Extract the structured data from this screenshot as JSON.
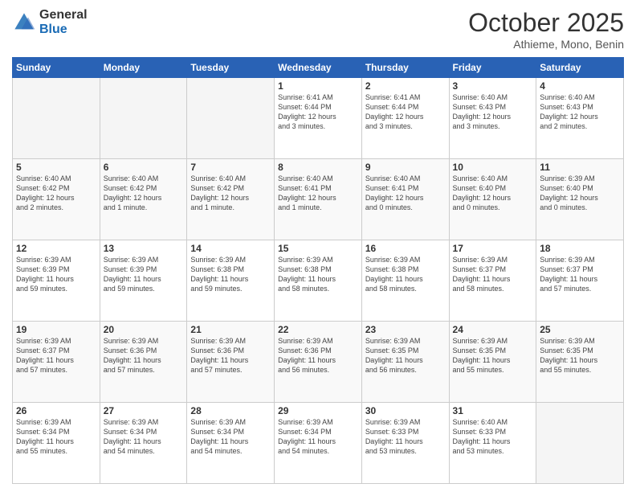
{
  "header": {
    "logo_general": "General",
    "logo_blue": "Blue",
    "title": "October 2025",
    "location": "Athieme, Mono, Benin"
  },
  "days_of_week": [
    "Sunday",
    "Monday",
    "Tuesday",
    "Wednesday",
    "Thursday",
    "Friday",
    "Saturday"
  ],
  "weeks": [
    [
      {
        "day": "",
        "info": ""
      },
      {
        "day": "",
        "info": ""
      },
      {
        "day": "",
        "info": ""
      },
      {
        "day": "1",
        "info": "Sunrise: 6:41 AM\nSunset: 6:44 PM\nDaylight: 12 hours\nand 3 minutes."
      },
      {
        "day": "2",
        "info": "Sunrise: 6:41 AM\nSunset: 6:44 PM\nDaylight: 12 hours\nand 3 minutes."
      },
      {
        "day": "3",
        "info": "Sunrise: 6:40 AM\nSunset: 6:43 PM\nDaylight: 12 hours\nand 3 minutes."
      },
      {
        "day": "4",
        "info": "Sunrise: 6:40 AM\nSunset: 6:43 PM\nDaylight: 12 hours\nand 2 minutes."
      }
    ],
    [
      {
        "day": "5",
        "info": "Sunrise: 6:40 AM\nSunset: 6:42 PM\nDaylight: 12 hours\nand 2 minutes."
      },
      {
        "day": "6",
        "info": "Sunrise: 6:40 AM\nSunset: 6:42 PM\nDaylight: 12 hours\nand 1 minute."
      },
      {
        "day": "7",
        "info": "Sunrise: 6:40 AM\nSunset: 6:42 PM\nDaylight: 12 hours\nand 1 minute."
      },
      {
        "day": "8",
        "info": "Sunrise: 6:40 AM\nSunset: 6:41 PM\nDaylight: 12 hours\nand 1 minute."
      },
      {
        "day": "9",
        "info": "Sunrise: 6:40 AM\nSunset: 6:41 PM\nDaylight: 12 hours\nand 0 minutes."
      },
      {
        "day": "10",
        "info": "Sunrise: 6:40 AM\nSunset: 6:40 PM\nDaylight: 12 hours\nand 0 minutes."
      },
      {
        "day": "11",
        "info": "Sunrise: 6:39 AM\nSunset: 6:40 PM\nDaylight: 12 hours\nand 0 minutes."
      }
    ],
    [
      {
        "day": "12",
        "info": "Sunrise: 6:39 AM\nSunset: 6:39 PM\nDaylight: 11 hours\nand 59 minutes."
      },
      {
        "day": "13",
        "info": "Sunrise: 6:39 AM\nSunset: 6:39 PM\nDaylight: 11 hours\nand 59 minutes."
      },
      {
        "day": "14",
        "info": "Sunrise: 6:39 AM\nSunset: 6:38 PM\nDaylight: 11 hours\nand 59 minutes."
      },
      {
        "day": "15",
        "info": "Sunrise: 6:39 AM\nSunset: 6:38 PM\nDaylight: 11 hours\nand 58 minutes."
      },
      {
        "day": "16",
        "info": "Sunrise: 6:39 AM\nSunset: 6:38 PM\nDaylight: 11 hours\nand 58 minutes."
      },
      {
        "day": "17",
        "info": "Sunrise: 6:39 AM\nSunset: 6:37 PM\nDaylight: 11 hours\nand 58 minutes."
      },
      {
        "day": "18",
        "info": "Sunrise: 6:39 AM\nSunset: 6:37 PM\nDaylight: 11 hours\nand 57 minutes."
      }
    ],
    [
      {
        "day": "19",
        "info": "Sunrise: 6:39 AM\nSunset: 6:37 PM\nDaylight: 11 hours\nand 57 minutes."
      },
      {
        "day": "20",
        "info": "Sunrise: 6:39 AM\nSunset: 6:36 PM\nDaylight: 11 hours\nand 57 minutes."
      },
      {
        "day": "21",
        "info": "Sunrise: 6:39 AM\nSunset: 6:36 PM\nDaylight: 11 hours\nand 57 minutes."
      },
      {
        "day": "22",
        "info": "Sunrise: 6:39 AM\nSunset: 6:36 PM\nDaylight: 11 hours\nand 56 minutes."
      },
      {
        "day": "23",
        "info": "Sunrise: 6:39 AM\nSunset: 6:35 PM\nDaylight: 11 hours\nand 56 minutes."
      },
      {
        "day": "24",
        "info": "Sunrise: 6:39 AM\nSunset: 6:35 PM\nDaylight: 11 hours\nand 55 minutes."
      },
      {
        "day": "25",
        "info": "Sunrise: 6:39 AM\nSunset: 6:35 PM\nDaylight: 11 hours\nand 55 minutes."
      }
    ],
    [
      {
        "day": "26",
        "info": "Sunrise: 6:39 AM\nSunset: 6:34 PM\nDaylight: 11 hours\nand 55 minutes."
      },
      {
        "day": "27",
        "info": "Sunrise: 6:39 AM\nSunset: 6:34 PM\nDaylight: 11 hours\nand 54 minutes."
      },
      {
        "day": "28",
        "info": "Sunrise: 6:39 AM\nSunset: 6:34 PM\nDaylight: 11 hours\nand 54 minutes."
      },
      {
        "day": "29",
        "info": "Sunrise: 6:39 AM\nSunset: 6:34 PM\nDaylight: 11 hours\nand 54 minutes."
      },
      {
        "day": "30",
        "info": "Sunrise: 6:39 AM\nSunset: 6:33 PM\nDaylight: 11 hours\nand 53 minutes."
      },
      {
        "day": "31",
        "info": "Sunrise: 6:40 AM\nSunset: 6:33 PM\nDaylight: 11 hours\nand 53 minutes."
      },
      {
        "day": "",
        "info": ""
      }
    ]
  ]
}
